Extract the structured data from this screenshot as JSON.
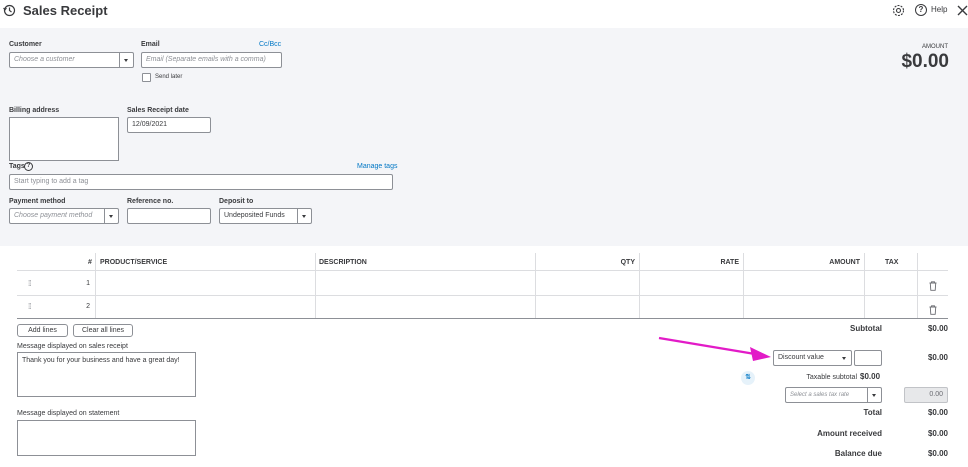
{
  "header": {
    "title": "Sales Receipt",
    "help_label": "Help"
  },
  "form": {
    "customer_label": "Customer",
    "customer_placeholder": "Choose a customer",
    "email_label": "Email",
    "email_placeholder": "Email (Separate emails with a comma)",
    "cc_bcc": "Cc/Bcc",
    "send_later": "Send later",
    "amount_label": "AMOUNT",
    "amount_value": "$0.00",
    "billing_label": "Billing address",
    "date_label": "Sales Receipt date",
    "date_value": "12/09/2021",
    "tags_label": "Tags",
    "manage_tags": "Manage tags",
    "tags_placeholder": "Start typing to add a tag",
    "payment_label": "Payment method",
    "payment_placeholder": "Choose payment method",
    "reference_label": "Reference no.",
    "deposit_label": "Deposit to",
    "deposit_value": "Undeposited Funds"
  },
  "table": {
    "headers": {
      "num": "#",
      "product": "PRODUCT/SERVICE",
      "description": "DESCRIPTION",
      "qty": "QTY",
      "rate": "RATE",
      "amount": "AMOUNT",
      "tax": "TAX"
    },
    "rows": [
      {
        "num": "1"
      },
      {
        "num": "2"
      }
    ],
    "add_lines": "Add lines",
    "clear_lines": "Clear all lines"
  },
  "messages": {
    "receipt_label": "Message displayed on sales receipt",
    "receipt_value": "Thank you for your business and have a great day!",
    "statement_label": "Message displayed on statement"
  },
  "totals": {
    "subtotal_label": "Subtotal",
    "subtotal_value": "$0.00",
    "discount_option": "Discount value",
    "discount_amount": "$0.00",
    "taxable_label": "Taxable subtotal",
    "taxable_value": "$0.00",
    "tax_rate_placeholder": "Select a sales tax rate",
    "tax_amount": "0.00",
    "total_label": "Total",
    "total_value": "$0.00",
    "received_label": "Amount received",
    "received_value": "$0.00",
    "balance_label": "Balance due",
    "balance_value": "$0.00"
  },
  "colors": {
    "accent": "#0077c5",
    "annotation_arrow": "#e21bc7",
    "panel_bg": "#f4f5f8"
  }
}
